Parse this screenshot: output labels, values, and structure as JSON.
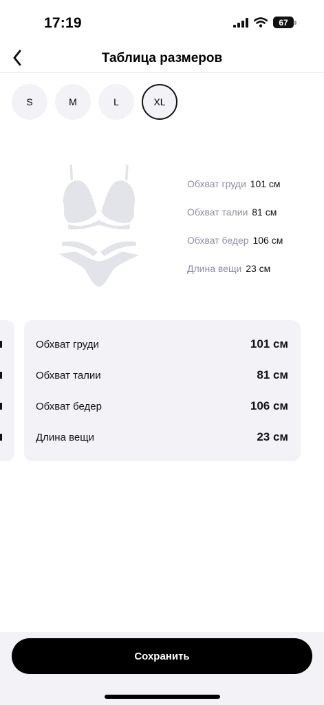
{
  "status_bar": {
    "time": "17:19",
    "battery": "67"
  },
  "header": {
    "title": "Таблица размеров"
  },
  "sizes": {
    "options": [
      "S",
      "M",
      "L",
      "XL"
    ],
    "selected": "XL"
  },
  "quick_specs": [
    {
      "label": "Обхват груди",
      "value": "101 см"
    },
    {
      "label": "Обхват талии",
      "value": "81 см"
    },
    {
      "label": "Обхват бедер",
      "value": "106 см"
    },
    {
      "label": "Длина вещи",
      "value": "23 см"
    }
  ],
  "size_card": {
    "rows": [
      {
        "label": "Обхват груди",
        "value": "101 см"
      },
      {
        "label": "Обхват талии",
        "value": "81 см"
      },
      {
        "label": "Обхват бедер",
        "value": "106 см"
      },
      {
        "label": "Длина вещи",
        "value": "23 см"
      }
    ]
  },
  "footer": {
    "save_label": "Сохранить"
  },
  "colors": {
    "muted_label": "#8e8ca5",
    "card_background": "#f3f3f7",
    "primary": "#000000"
  }
}
